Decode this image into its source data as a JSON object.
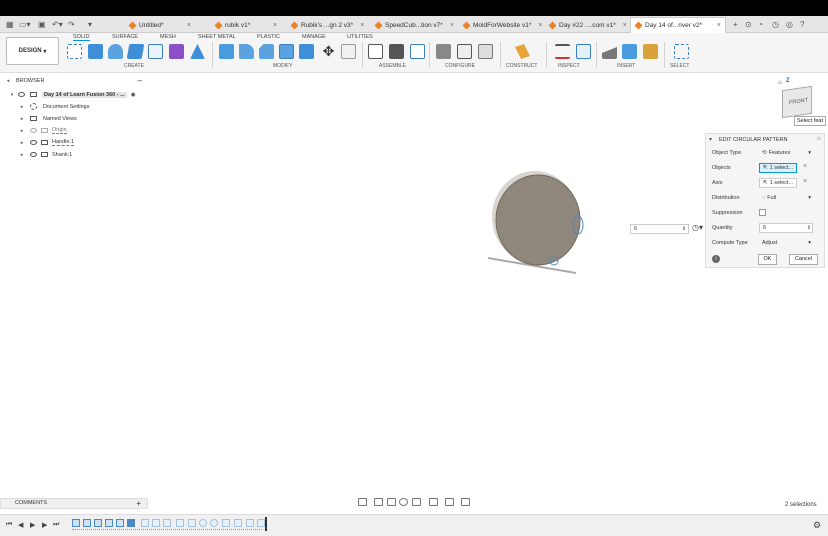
{
  "tabs": [
    {
      "label": "Untitled*"
    },
    {
      "label": "rubik v1*"
    },
    {
      "label": "Rubik's ...gn 2 v3*"
    },
    {
      "label": "SpeedCub...tion v7*"
    },
    {
      "label": "MoldForWebsite v1*"
    },
    {
      "label": "Day #22 ....com v1*"
    },
    {
      "label": "Day 14 of...river v2*"
    }
  ],
  "user_initials": "JK",
  "workspace": "DESIGN",
  "toolbar_tabs": [
    "SOLID",
    "SURFACE",
    "MESH",
    "SHEET METAL",
    "PLASTIC",
    "MANAGE",
    "UTILITIES"
  ],
  "groups": {
    "create": "CREATE",
    "modify": "MODIFY",
    "assemble": "ASSEMBLE",
    "configure": "CONFIGURE",
    "construct": "CONSTRUCT",
    "inspect": "INSPECT",
    "insert": "INSERT",
    "select": "SELECT"
  },
  "browser": {
    "title": "BROWSER",
    "root": "Day 14 of Learn Fusion 360 - ...",
    "items": [
      "Document Settings",
      "Named Views",
      "Origin",
      "Handle:1",
      "Shank:1"
    ]
  },
  "viewcube": {
    "face": "FRONT",
    "axis": "Z",
    "tooltip": "Select feat"
  },
  "quantity_input": "6",
  "panel": {
    "title": "EDIT CIRCULAR PATTERN",
    "object_type_label": "Object Type",
    "object_type_value": "Features",
    "objects_label": "Objects",
    "objects_value": "1 select...",
    "axis_label": "Axis",
    "axis_value": "1 select...",
    "distribution_label": "Distribution",
    "distribution_value": "Full",
    "suppression_label": "Suppression",
    "quantity_label": "Quantity",
    "quantity_value": "6",
    "compute_label": "Compute Type",
    "compute_value": "Adjust",
    "ok": "OK",
    "cancel": "Cancel"
  },
  "comments": "COMMENTS",
  "status": "2 selections",
  "colors": {
    "accent": "#0696d7",
    "part": "#8f877c",
    "tab_icon": "#e8822b"
  }
}
